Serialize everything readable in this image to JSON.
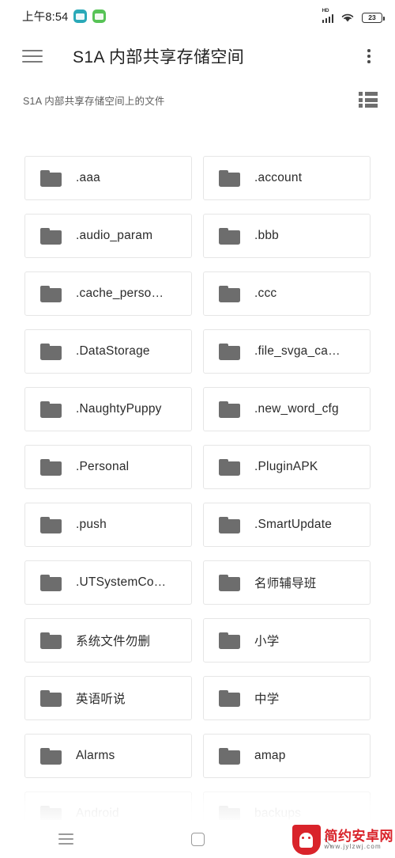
{
  "status_bar": {
    "time": "上午8:54",
    "app_icons": [
      {
        "name": "weather-app-icon",
        "color": "#2aa9b8"
      },
      {
        "name": "notes-app-icon",
        "color": "#57c356"
      }
    ],
    "hd_label": "HD",
    "signal_icon": "cellular-signal-icon",
    "wifi_icon": "wifi-icon",
    "battery_icon": "battery-icon",
    "battery_level": "23"
  },
  "header": {
    "menu_icon": "hamburger-menu-icon",
    "title": "S1A 内部共享存储空间",
    "overflow_icon": "overflow-menu-icon"
  },
  "subheader": {
    "label": "S1A 内部共享存储空间上的文件",
    "view_toggle_icon": "list-view-icon"
  },
  "files": [
    {
      "name": ".aaa",
      "type": "folder",
      "truncated": false
    },
    {
      "name": ".account",
      "type": "folder",
      "truncated": false
    },
    {
      "name": ".audio_param",
      "type": "folder",
      "truncated": false
    },
    {
      "name": ".bbb",
      "type": "folder",
      "truncated": false
    },
    {
      "name": ".cache_perso…",
      "type": "folder",
      "truncated": true
    },
    {
      "name": ".ccc",
      "type": "folder",
      "truncated": false
    },
    {
      "name": ".DataStorage",
      "type": "folder",
      "truncated": false
    },
    {
      "name": ".file_svga_ca…",
      "type": "folder",
      "truncated": true
    },
    {
      "name": ".NaughtyPuppy",
      "type": "folder",
      "truncated": false
    },
    {
      "name": ".new_word_cfg",
      "type": "folder",
      "truncated": false
    },
    {
      "name": ".Personal",
      "type": "folder",
      "truncated": false
    },
    {
      "name": ".PluginAPK",
      "type": "folder",
      "truncated": false
    },
    {
      "name": ".push",
      "type": "folder",
      "truncated": false
    },
    {
      "name": ".SmartUpdate",
      "type": "folder",
      "truncated": false
    },
    {
      "name": ".UTSystemCo…",
      "type": "folder",
      "truncated": true
    },
    {
      "name": "名师辅导班",
      "type": "folder",
      "truncated": false
    },
    {
      "name": "系统文件勿删",
      "type": "folder",
      "truncated": false
    },
    {
      "name": "小学",
      "type": "folder",
      "truncated": false
    },
    {
      "name": "英语听说",
      "type": "folder",
      "truncated": false
    },
    {
      "name": "中学",
      "type": "folder",
      "truncated": false
    },
    {
      "name": "Alarms",
      "type": "folder",
      "truncated": false
    },
    {
      "name": "amap",
      "type": "folder",
      "truncated": false
    },
    {
      "name": "Android",
      "type": "folder",
      "truncated": false
    },
    {
      "name": "backups",
      "type": "folder",
      "truncated": false
    }
  ],
  "nav_bar": {
    "recent_icon": "recent-apps-icon",
    "home_icon": "home-icon",
    "back_icon": "back-icon"
  },
  "watermark": {
    "logo_icon": "android-shield-logo-icon",
    "title": "简约安卓网",
    "url": "www.jylzwj.com",
    "color": "#d9232a"
  }
}
